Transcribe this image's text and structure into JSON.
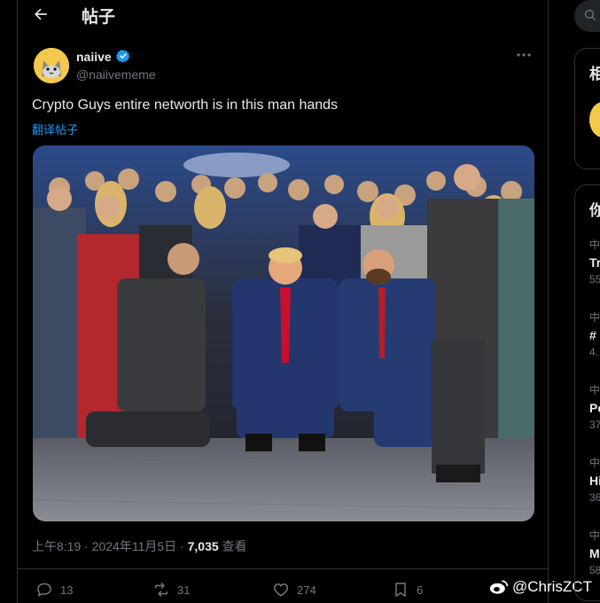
{
  "header": {
    "title": "帖子"
  },
  "author": {
    "name": "naiive",
    "handle": "@naiivememe"
  },
  "tweet": {
    "text": "Crypto Guys entire networth is in this man hands",
    "translate_label": "翻译帖子",
    "timestamp": "上午8:19 · 2024年11月5日 · ",
    "views_count": "7,035",
    "views_label": " 查看"
  },
  "actions": {
    "replies": "13",
    "reposts": "31",
    "likes": "274",
    "bookmarks": "6"
  },
  "watermark": {
    "text": "@ChrisZCT"
  },
  "right_sidebar": {
    "card1_heading": "相",
    "card2_heading": "你",
    "trends": [
      {
        "t1": "中",
        "t2": "Tr",
        "t3": "55"
      },
      {
        "t1": "中",
        "t2": "#",
        "t3": "4."
      },
      {
        "t1": "中",
        "t2": "Pc",
        "t3": "37"
      },
      {
        "t1": "中",
        "t2": "Hi",
        "t3": "36"
      },
      {
        "t1": "中",
        "t2": "M",
        "t3": "58"
      }
    ]
  },
  "colors": {
    "accent": "#1d9bf0",
    "background": "#000000",
    "muted": "#71767b",
    "text": "#e7e9ea"
  }
}
